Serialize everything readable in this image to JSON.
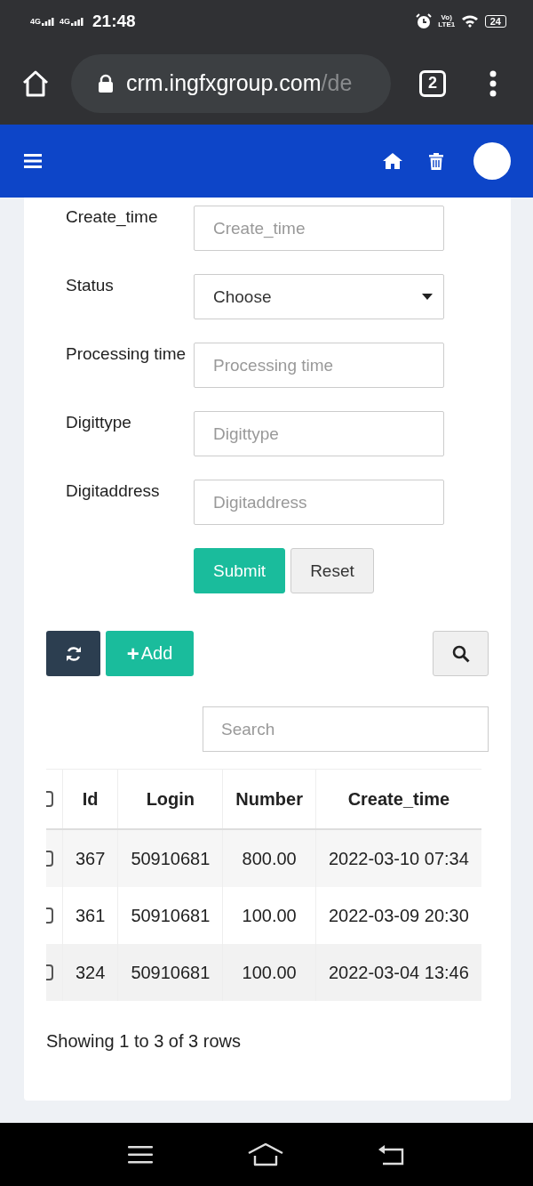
{
  "status_bar": {
    "signal_labels": [
      "4G",
      "4G"
    ],
    "time": "21:48",
    "volte": "Vo) LTE1",
    "battery": "24"
  },
  "browser": {
    "url_host": "crm.ingfxgroup.com",
    "url_path": "/de",
    "tab_count": "2"
  },
  "form": {
    "fields": [
      {
        "label": "Create_time",
        "kind": "text",
        "placeholder": "Create_time"
      },
      {
        "label": "Status",
        "kind": "select",
        "value": "Choose"
      },
      {
        "label": "Processing time",
        "kind": "text",
        "placeholder": "Processing time"
      },
      {
        "label": "Digittype",
        "kind": "text",
        "placeholder": "Digittype"
      },
      {
        "label": "Digitaddress",
        "kind": "text",
        "placeholder": "Digitaddress"
      }
    ],
    "buttons": [
      {
        "label": "Submit",
        "kind": "primary"
      },
      {
        "label": "Reset",
        "kind": "default"
      }
    ]
  },
  "toolbar": {
    "add_label": "Add",
    "add_icon": "+"
  },
  "search": {
    "placeholder": "Search"
  },
  "table": {
    "select_all_checked": false,
    "columns": [
      "Id",
      "Login",
      "Number",
      "Create_time"
    ],
    "rows": [
      {
        "checked": false,
        "cells": [
          "367",
          "50910681",
          "800.00",
          "2022-03-10 07:34"
        ]
      },
      {
        "checked": false,
        "cells": [
          "361",
          "50910681",
          "100.00",
          "2022-03-09 20:30"
        ]
      },
      {
        "checked": false,
        "cells": [
          "324",
          "50910681",
          "100.00",
          "2022-03-04 13:46"
        ]
      }
    ]
  },
  "pagination": {
    "summary": "Showing 1 to 3 of 3 rows"
  }
}
